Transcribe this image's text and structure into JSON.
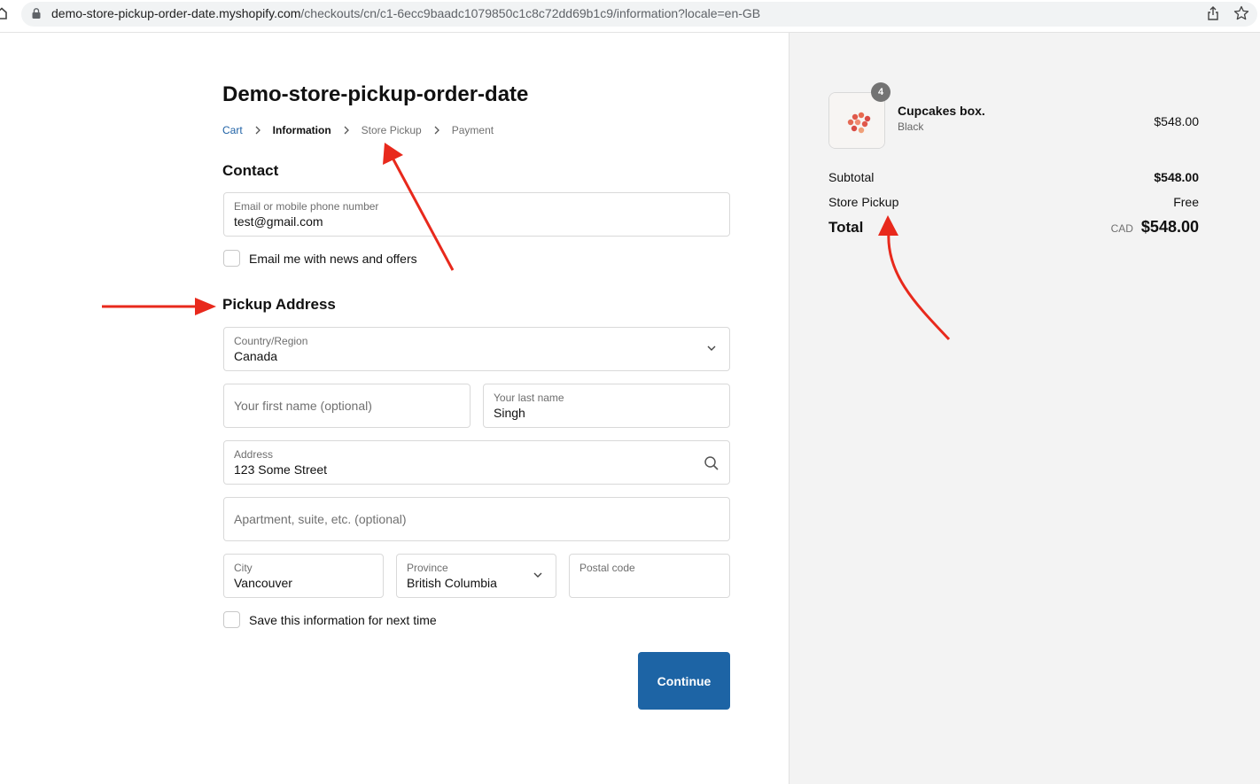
{
  "browser": {
    "url_host": "demo-store-pickup-order-date.myshopify.com",
    "url_path": "/checkouts/cn/c1-6ecc9baadc1079850c1c8c72dd69b1c9/information?locale=en-GB"
  },
  "store": {
    "title": "Demo-store-pickup-order-date"
  },
  "breadcrumb": [
    "Cart",
    "Information",
    "Store Pickup",
    "Payment"
  ],
  "contact": {
    "title": "Contact",
    "email_label": "Email or mobile phone number",
    "email_value": "test@gmail.com",
    "news_label": "Email me with news and offers",
    "news_checked": false
  },
  "pickup": {
    "title": "Pickup Address",
    "country_label": "Country/Region",
    "country_value": "Canada",
    "first_name_placeholder": "Your first name (optional)",
    "last_name_label": "Your last name",
    "last_name_value": "Singh",
    "address_label": "Address",
    "address_value": "123 Some Street",
    "apartment_placeholder": "Apartment, suite, etc. (optional)",
    "city_label": "City",
    "city_value": "Vancouver",
    "province_label": "Province",
    "province_value": "British Columbia",
    "postal_label": "Postal code",
    "save_label": "Save this information for next time",
    "save_checked": false
  },
  "actions": {
    "continue_label": "Continue"
  },
  "summary": {
    "product_name": "Cupcakes box.",
    "product_variant": "Black",
    "product_price": "$548.00",
    "quantity": "4",
    "subtotal_label": "Subtotal",
    "subtotal_value": "$548.00",
    "shipping_label": "Store Pickup",
    "shipping_value": "Free",
    "total_label": "Total",
    "currency": "CAD",
    "total_value": "$548.00"
  },
  "colors": {
    "accent": "#1d64a5",
    "link": "#1f62a6",
    "annotation_arrow": "#e8291c",
    "sidebar_bg": "#f3f3f3"
  }
}
